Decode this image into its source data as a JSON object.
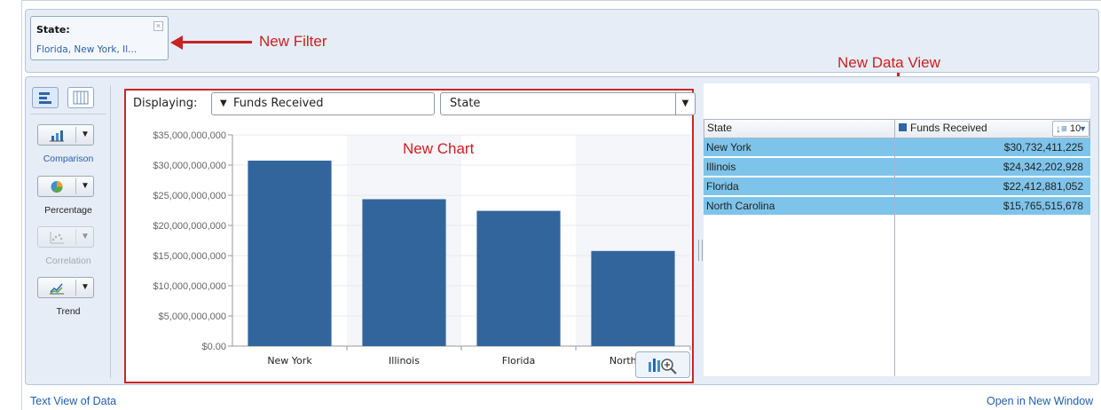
{
  "filter": {
    "title": "State:",
    "value": "Florida, New York, Il...",
    "close_glyph": "×"
  },
  "annotations": {
    "new_filter": "New Filter",
    "new_data_view": "New Data View",
    "new_chart": "New Chart"
  },
  "toolbar": {
    "comparison_label": "Comparison",
    "percentage_label": "Percentage",
    "correlation_label": "Correlation",
    "trend_label": "Trend",
    "dropdown_glyph": "▼"
  },
  "chart_controls": {
    "displaying_label": "Displaying:",
    "measure_value": "Funds Received",
    "dimension_value": "State",
    "caret_glyph": "▼"
  },
  "chart_data": {
    "type": "bar",
    "categories": [
      "New York",
      "Illinois",
      "Florida",
      "North Carolina"
    ],
    "tick_labels": [
      "New York",
      "Illinois",
      "Florida",
      "North Car"
    ],
    "values": [
      30732411225,
      24342202928,
      22412881052,
      15765515678
    ],
    "yticks": [
      "$0.00",
      "$5,000,000,000",
      "$10,000,000,000",
      "$15,000,000,000",
      "$20,000,000,000",
      "$25,000,000,000",
      "$30,000,000,000",
      "$35,000,000,000"
    ],
    "ylim": [
      0,
      35000000000
    ],
    "bar_color": "#33659d",
    "grid": true
  },
  "table": {
    "col_state": "State",
    "col_funds": "Funds Received",
    "top_n": "10",
    "rows": [
      {
        "state": "New York",
        "funds": "$30,732,411,225"
      },
      {
        "state": "Illinois",
        "funds": "$24,342,202,928"
      },
      {
        "state": "Florida",
        "funds": "$22,412,881,052"
      },
      {
        "state": "North Carolina",
        "funds": "$15,765,515,678"
      }
    ]
  },
  "footer": {
    "text_view": "Text View of Data",
    "open_new": "Open in New Window"
  },
  "colors": {
    "accent_red": "#cc2525",
    "row_highlight": "#7ec4ea",
    "series": "#33659d"
  }
}
